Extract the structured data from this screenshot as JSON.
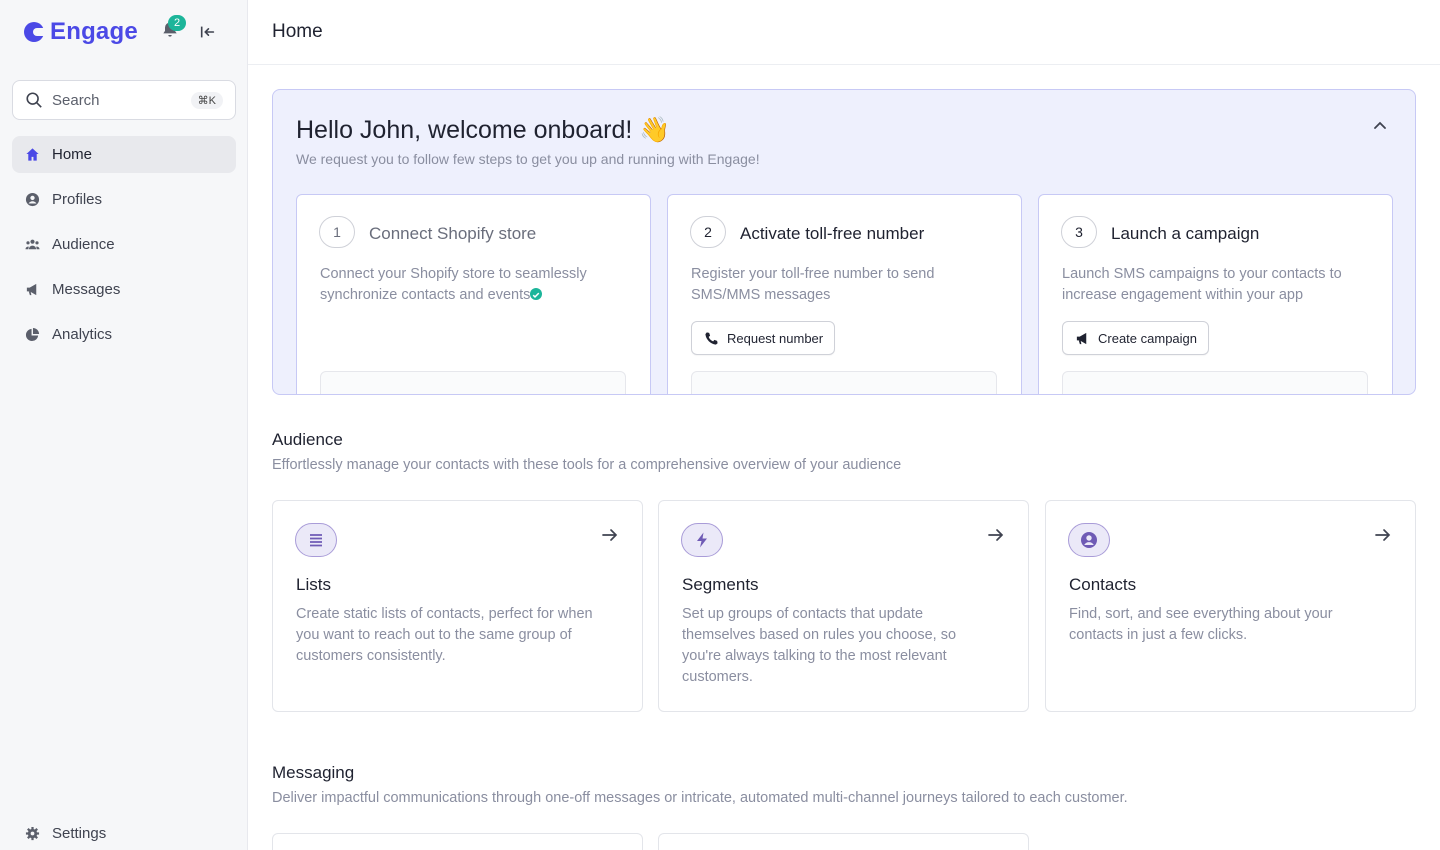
{
  "app": {
    "brand": "Engage",
    "notification_count": "2"
  },
  "search": {
    "label": "Search",
    "shortcut": "⌘K"
  },
  "sidebar": {
    "items": [
      {
        "label": "Home",
        "icon": "home-icon"
      },
      {
        "label": "Profiles",
        "icon": "profile-icon"
      },
      {
        "label": "Audience",
        "icon": "users-icon"
      },
      {
        "label": "Messages",
        "icon": "megaphone-icon"
      },
      {
        "label": "Analytics",
        "icon": "pie-chart-icon"
      }
    ],
    "settings": "Settings"
  },
  "header": {
    "title": "Home"
  },
  "onboarding": {
    "title": "Hello John, welcome onboard! 👋",
    "subtitle": "We request you to follow few steps to get you up and running with Engage!",
    "steps": [
      {
        "number": "1",
        "title": "Connect Shopify store",
        "desc": "Connect your Shopify store to seamlessly synchronize contacts and events",
        "completed": true
      },
      {
        "number": "2",
        "title": "Activate toll-free number",
        "desc": "Register your toll-free number to send SMS/MMS messages",
        "button": "Request number"
      },
      {
        "number": "3",
        "title": "Launch a campaign",
        "desc": "Launch SMS campaigns to your contacts to increase engagement within your app",
        "button": "Create campaign"
      }
    ]
  },
  "audience": {
    "title": "Audience",
    "subtitle": "Effortlessly manage your contacts with these tools for a comprehensive overview of your audience",
    "cards": [
      {
        "title": "Lists",
        "desc": "Create static lists of contacts, perfect for when you want to reach out to the same group of customers consistently.",
        "icon": "list-icon"
      },
      {
        "title": "Segments",
        "desc": "Set up groups of contacts that update themselves based on rules you choose, so you're always talking to the most relevant customers.",
        "icon": "lightning-icon"
      },
      {
        "title": "Contacts",
        "desc": "Find, sort, and see everything about your contacts in just a few clicks.",
        "icon": "user-circle-icon"
      }
    ]
  },
  "messaging": {
    "title": "Messaging",
    "subtitle": "Deliver impactful communications through one-off messages or intricate, automated multi-channel journeys tailored to each customer."
  },
  "colors": {
    "accent": "#4b49e6",
    "badge": "#1cb59a",
    "onboard_bg": "#eef0fd"
  }
}
